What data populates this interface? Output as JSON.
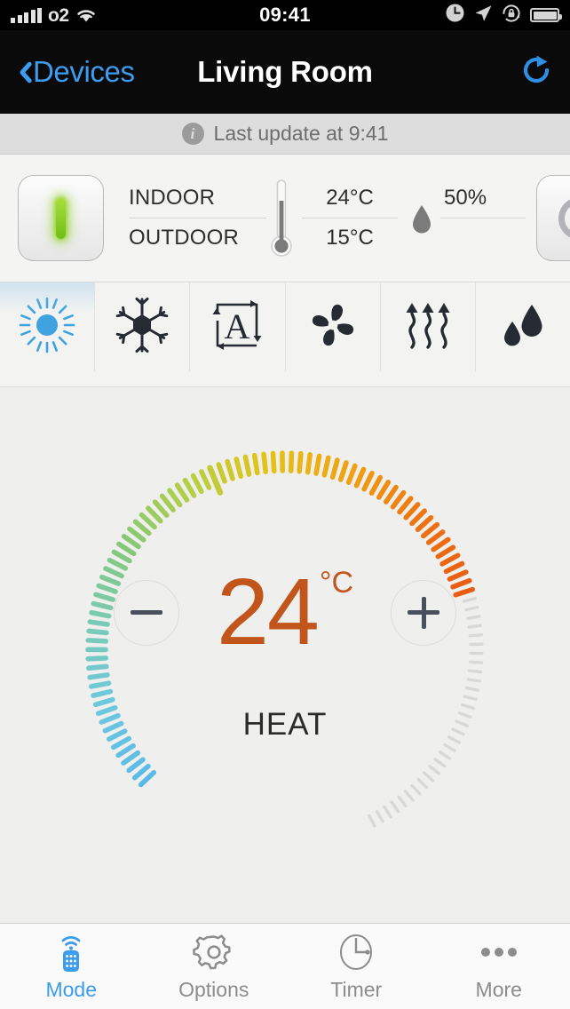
{
  "status_bar": {
    "carrier": "o2",
    "time": "09:41",
    "signal_bars": 5,
    "icons": [
      "signal-icon",
      "wifi-icon",
      "alarm-clock-icon",
      "location-arrow-icon",
      "rotation-lock-icon",
      "battery-icon"
    ]
  },
  "nav": {
    "back_label": "Devices",
    "title": "Living Room",
    "refresh_icon": "refresh-icon",
    "accent": "#3b9cf0"
  },
  "update_bar": {
    "info_icon": "info-icon",
    "text": "Last update at 9:41"
  },
  "info_panel": {
    "power_on": {
      "name": "power-on-button",
      "glyph": "I",
      "color": "#8dd121",
      "state": "active"
    },
    "power_off": {
      "name": "power-off-button",
      "glyph": "O",
      "color": "#b2b2b8",
      "state": "inactive"
    },
    "thermometer_icon": "thermometer-icon",
    "humidity_icon": "water-drop-icon",
    "rows": [
      {
        "label": "INDOOR",
        "temperature": "24°C",
        "humidity": "50%"
      },
      {
        "label": "OUTDOOR",
        "temperature": "15°C",
        "humidity": ""
      }
    ]
  },
  "modes": [
    {
      "name": "mode-heat-sun",
      "icon": "sun-icon",
      "selected": true
    },
    {
      "name": "mode-cool",
      "icon": "snowflake-icon",
      "selected": false
    },
    {
      "name": "mode-auto",
      "icon": "auto-a-icon",
      "selected": false
    },
    {
      "name": "mode-fan",
      "icon": "fan-icon",
      "selected": false
    },
    {
      "name": "mode-heat-waves",
      "icon": "heat-waves-icon",
      "selected": false
    },
    {
      "name": "mode-dehumidify",
      "icon": "droplets-icon",
      "selected": false
    }
  ],
  "dial": {
    "value": "24",
    "unit": "°C",
    "mode_label": "HEAT",
    "value_color": "#c2551b",
    "decrease_label": "−",
    "increase_label": "+",
    "active_ticks": 76,
    "inactive_ticks": 30,
    "gradient_stops": [
      "#5bb9e8",
      "#6dc8de",
      "#79cbb6",
      "#86c878",
      "#b4cf46",
      "#e6c214",
      "#efa013",
      "#ee7314",
      "#e85c12"
    ]
  },
  "tabs": [
    {
      "name": "tab-mode",
      "label": "Mode",
      "icon": "remote-control-icon",
      "selected": true
    },
    {
      "name": "tab-options",
      "label": "Options",
      "icon": "gear-icon",
      "selected": false
    },
    {
      "name": "tab-timer",
      "label": "Timer",
      "icon": "clock-icon",
      "selected": false
    },
    {
      "name": "tab-more",
      "label": "More",
      "icon": "ellipsis-icon",
      "selected": false
    }
  ]
}
